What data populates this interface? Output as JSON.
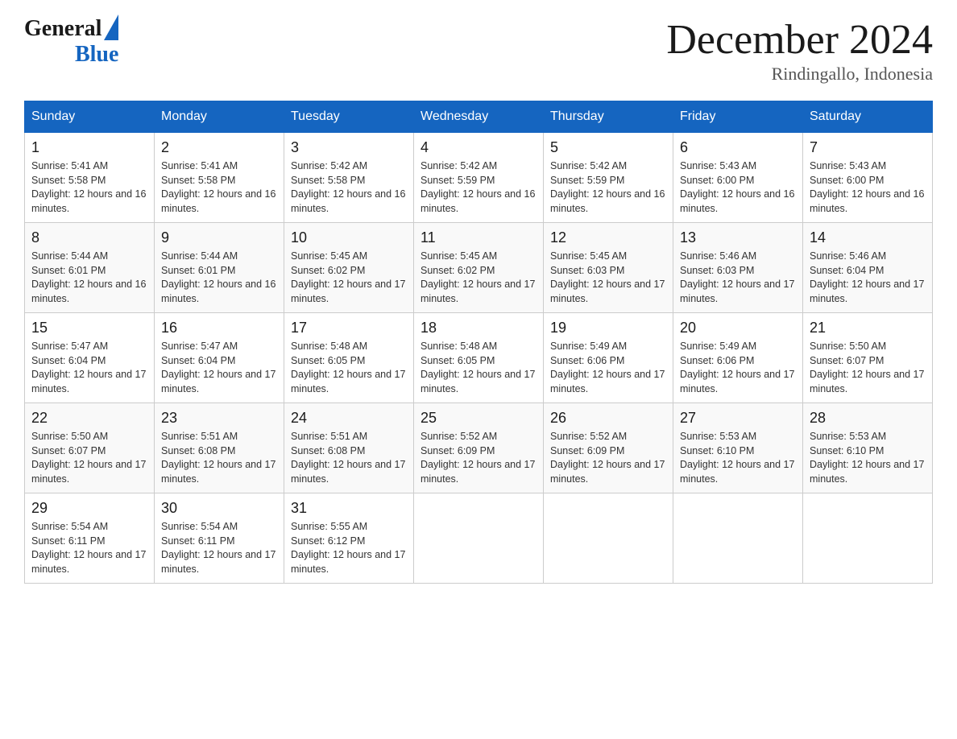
{
  "header": {
    "logo_general": "General",
    "logo_blue": "Blue",
    "title": "December 2024",
    "subtitle": "Rindingallo, Indonesia"
  },
  "columns": [
    "Sunday",
    "Monday",
    "Tuesday",
    "Wednesday",
    "Thursday",
    "Friday",
    "Saturday"
  ],
  "weeks": [
    [
      {
        "day": "1",
        "sunrise": "5:41 AM",
        "sunset": "5:58 PM",
        "daylight": "12 hours and 16 minutes."
      },
      {
        "day": "2",
        "sunrise": "5:41 AM",
        "sunset": "5:58 PM",
        "daylight": "12 hours and 16 minutes."
      },
      {
        "day": "3",
        "sunrise": "5:42 AM",
        "sunset": "5:58 PM",
        "daylight": "12 hours and 16 minutes."
      },
      {
        "day": "4",
        "sunrise": "5:42 AM",
        "sunset": "5:59 PM",
        "daylight": "12 hours and 16 minutes."
      },
      {
        "day": "5",
        "sunrise": "5:42 AM",
        "sunset": "5:59 PM",
        "daylight": "12 hours and 16 minutes."
      },
      {
        "day": "6",
        "sunrise": "5:43 AM",
        "sunset": "6:00 PM",
        "daylight": "12 hours and 16 minutes."
      },
      {
        "day": "7",
        "sunrise": "5:43 AM",
        "sunset": "6:00 PM",
        "daylight": "12 hours and 16 minutes."
      }
    ],
    [
      {
        "day": "8",
        "sunrise": "5:44 AM",
        "sunset": "6:01 PM",
        "daylight": "12 hours and 16 minutes."
      },
      {
        "day": "9",
        "sunrise": "5:44 AM",
        "sunset": "6:01 PM",
        "daylight": "12 hours and 16 minutes."
      },
      {
        "day": "10",
        "sunrise": "5:45 AM",
        "sunset": "6:02 PM",
        "daylight": "12 hours and 17 minutes."
      },
      {
        "day": "11",
        "sunrise": "5:45 AM",
        "sunset": "6:02 PM",
        "daylight": "12 hours and 17 minutes."
      },
      {
        "day": "12",
        "sunrise": "5:45 AM",
        "sunset": "6:03 PM",
        "daylight": "12 hours and 17 minutes."
      },
      {
        "day": "13",
        "sunrise": "5:46 AM",
        "sunset": "6:03 PM",
        "daylight": "12 hours and 17 minutes."
      },
      {
        "day": "14",
        "sunrise": "5:46 AM",
        "sunset": "6:04 PM",
        "daylight": "12 hours and 17 minutes."
      }
    ],
    [
      {
        "day": "15",
        "sunrise": "5:47 AM",
        "sunset": "6:04 PM",
        "daylight": "12 hours and 17 minutes."
      },
      {
        "day": "16",
        "sunrise": "5:47 AM",
        "sunset": "6:04 PM",
        "daylight": "12 hours and 17 minutes."
      },
      {
        "day": "17",
        "sunrise": "5:48 AM",
        "sunset": "6:05 PM",
        "daylight": "12 hours and 17 minutes."
      },
      {
        "day": "18",
        "sunrise": "5:48 AM",
        "sunset": "6:05 PM",
        "daylight": "12 hours and 17 minutes."
      },
      {
        "day": "19",
        "sunrise": "5:49 AM",
        "sunset": "6:06 PM",
        "daylight": "12 hours and 17 minutes."
      },
      {
        "day": "20",
        "sunrise": "5:49 AM",
        "sunset": "6:06 PM",
        "daylight": "12 hours and 17 minutes."
      },
      {
        "day": "21",
        "sunrise": "5:50 AM",
        "sunset": "6:07 PM",
        "daylight": "12 hours and 17 minutes."
      }
    ],
    [
      {
        "day": "22",
        "sunrise": "5:50 AM",
        "sunset": "6:07 PM",
        "daylight": "12 hours and 17 minutes."
      },
      {
        "day": "23",
        "sunrise": "5:51 AM",
        "sunset": "6:08 PM",
        "daylight": "12 hours and 17 minutes."
      },
      {
        "day": "24",
        "sunrise": "5:51 AM",
        "sunset": "6:08 PM",
        "daylight": "12 hours and 17 minutes."
      },
      {
        "day": "25",
        "sunrise": "5:52 AM",
        "sunset": "6:09 PM",
        "daylight": "12 hours and 17 minutes."
      },
      {
        "day": "26",
        "sunrise": "5:52 AM",
        "sunset": "6:09 PM",
        "daylight": "12 hours and 17 minutes."
      },
      {
        "day": "27",
        "sunrise": "5:53 AM",
        "sunset": "6:10 PM",
        "daylight": "12 hours and 17 minutes."
      },
      {
        "day": "28",
        "sunrise": "5:53 AM",
        "sunset": "6:10 PM",
        "daylight": "12 hours and 17 minutes."
      }
    ],
    [
      {
        "day": "29",
        "sunrise": "5:54 AM",
        "sunset": "6:11 PM",
        "daylight": "12 hours and 17 minutes."
      },
      {
        "day": "30",
        "sunrise": "5:54 AM",
        "sunset": "6:11 PM",
        "daylight": "12 hours and 17 minutes."
      },
      {
        "day": "31",
        "sunrise": "5:55 AM",
        "sunset": "6:12 PM",
        "daylight": "12 hours and 17 minutes."
      },
      null,
      null,
      null,
      null
    ]
  ]
}
